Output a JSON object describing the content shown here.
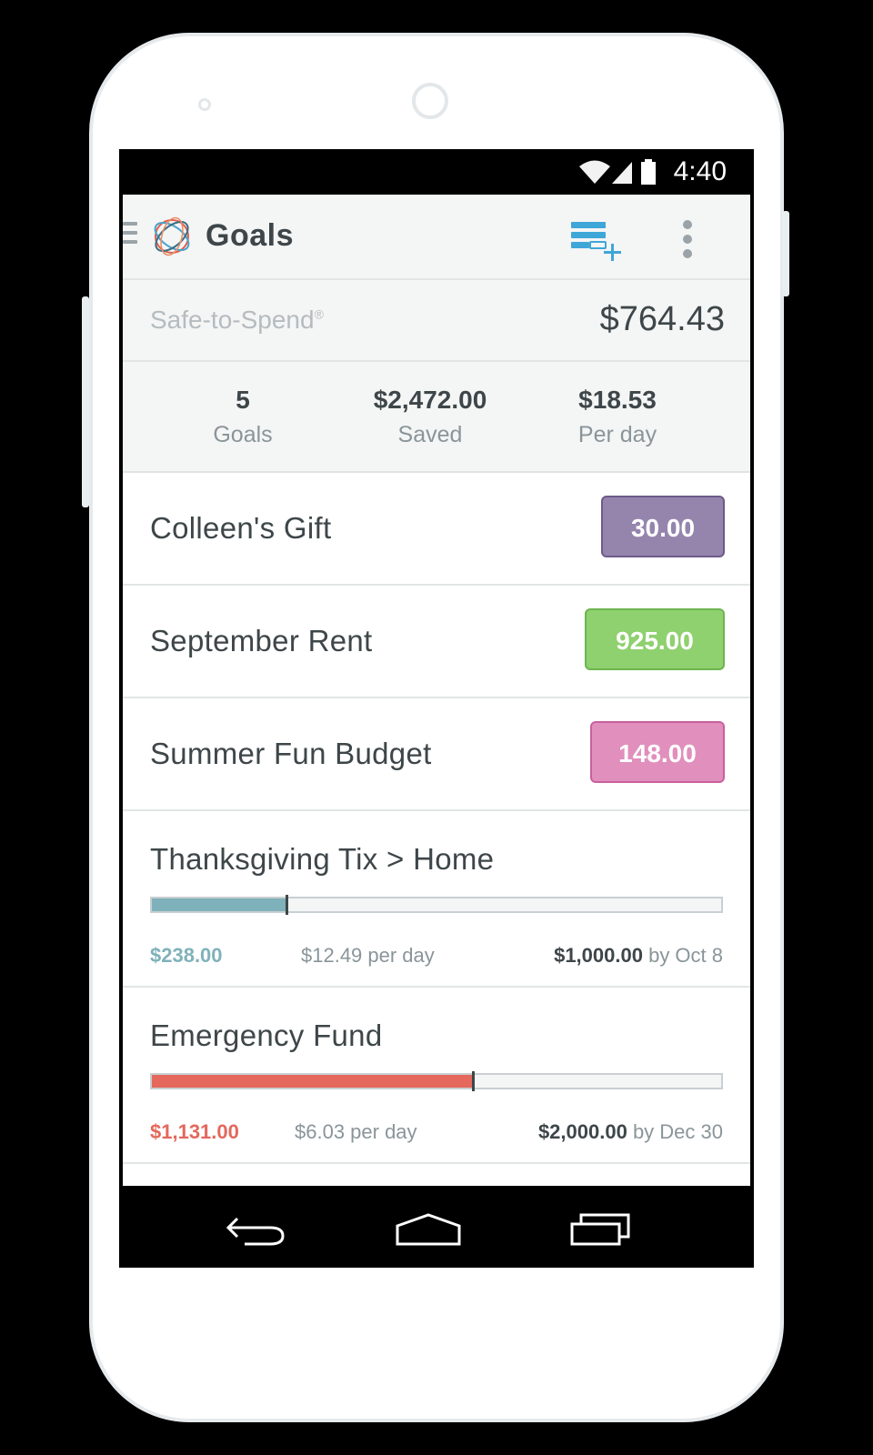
{
  "status_bar": {
    "time": "4:40"
  },
  "toolbar": {
    "title": "Goals"
  },
  "safe_to_spend": {
    "label": "Safe-to-Spend",
    "mark": "®",
    "value": "$764.43"
  },
  "stats": [
    {
      "value": "5",
      "label": "Goals"
    },
    {
      "value": "$2,472.00",
      "label": "Saved"
    },
    {
      "value": "$18.53",
      "label": "Per day"
    }
  ],
  "goals": [
    {
      "name": "Colleen's Gift",
      "amount": "30.00",
      "color": "#9585ad",
      "border": "#6c5b88"
    },
    {
      "name": "September Rent",
      "amount": "925.00",
      "color": "#8fd06f",
      "border": "#6eb54e"
    },
    {
      "name": "Summer Fun Budget",
      "amount": "148.00",
      "color": "#e18fbd",
      "border": "#c9609e"
    }
  ],
  "progress_goals": [
    {
      "name": "Thanksgiving Tix > Home",
      "saved": "$238.00",
      "rate": "$12.49 per day",
      "target": "$1,000.00",
      "due": "by Oct 8",
      "progress": 0.238,
      "color": "#7fb1ba"
    },
    {
      "name": "Emergency Fund",
      "saved": "$1,131.00",
      "rate": "$6.03 per day",
      "target": "$2,000.00",
      "due": "by Dec 30",
      "progress": 0.5655,
      "color": "#e4685c"
    }
  ],
  "icons": {
    "menu": "menu-icon",
    "logo": "logo-icon",
    "add_goal": "add-goal-icon",
    "overflow": "overflow-icon",
    "wifi": "wifi-icon",
    "signal": "signal-icon",
    "battery": "battery-icon",
    "back": "back-icon",
    "home": "home-icon",
    "recents": "recents-icon"
  }
}
